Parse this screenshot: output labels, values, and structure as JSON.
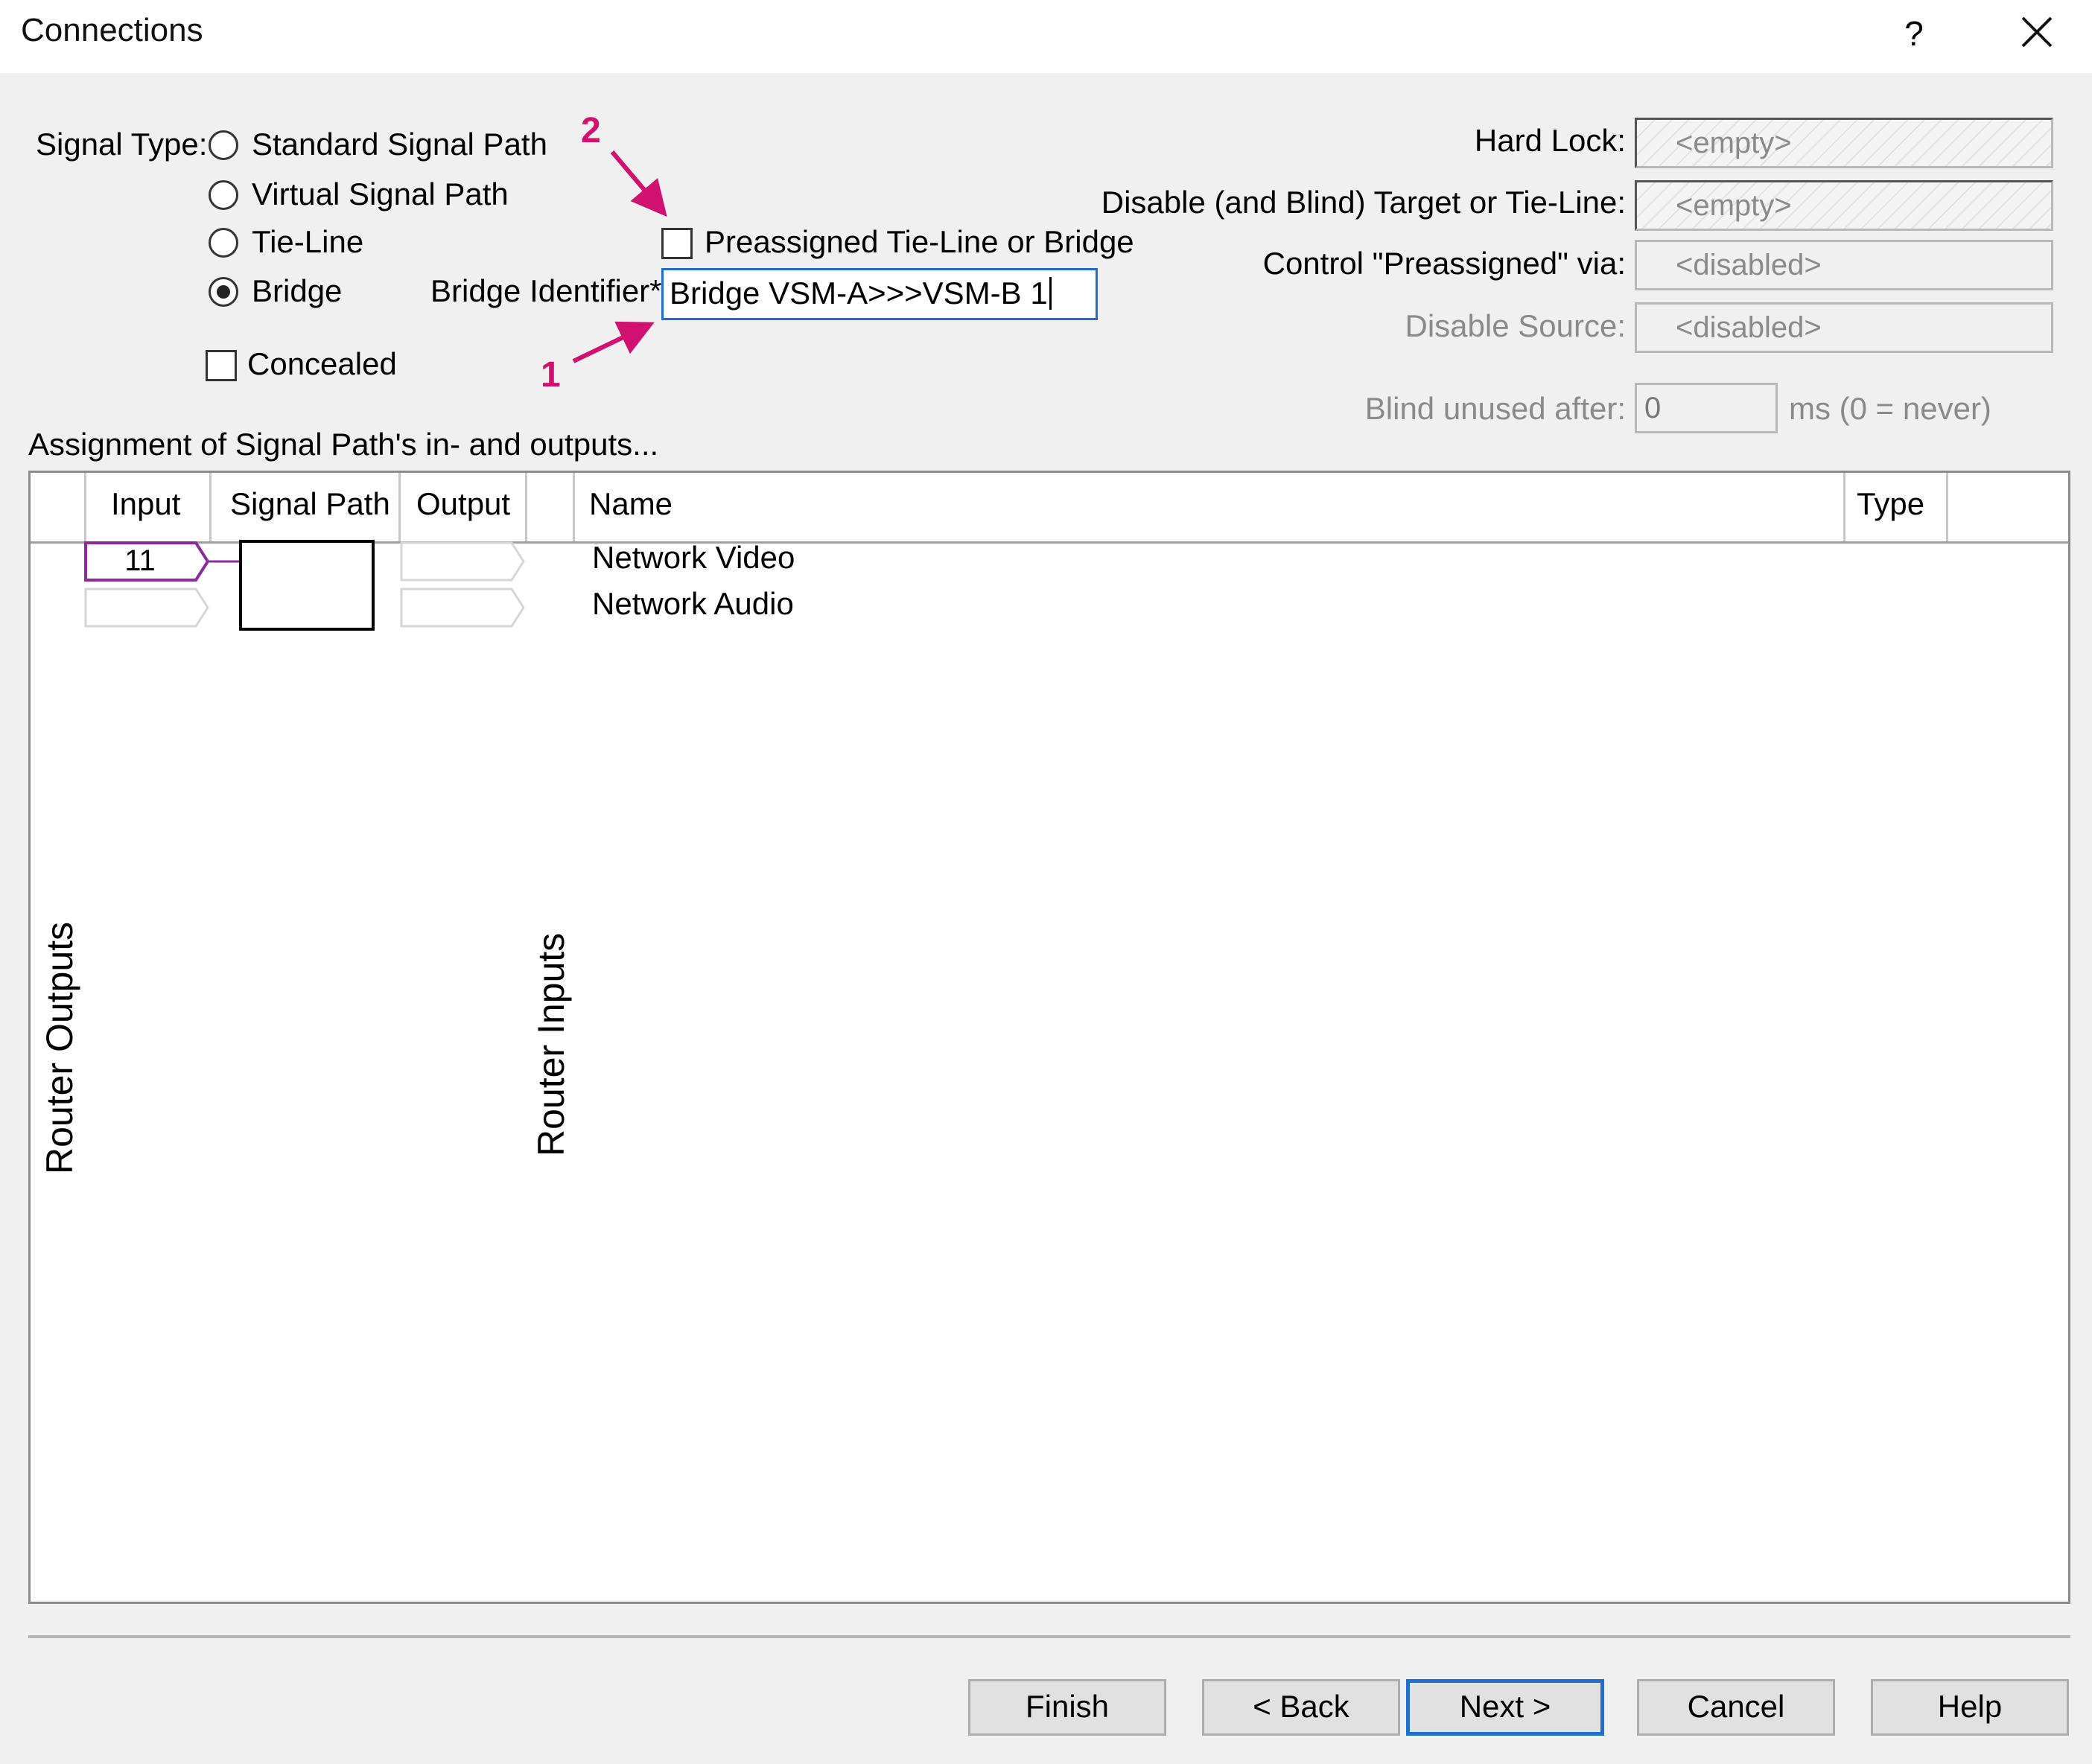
{
  "window": {
    "title": "Connections",
    "help_glyph": "?",
    "close_icon": "close-icon"
  },
  "signal_type": {
    "label": "Signal Type:",
    "options": [
      {
        "label": "Standard Signal Path",
        "checked": false
      },
      {
        "label": "Virtual Signal Path",
        "checked": false
      },
      {
        "label": "Tie-Line",
        "checked": false
      },
      {
        "label": "Bridge",
        "checked": true
      }
    ],
    "concealed_label": "Concealed",
    "concealed_checked": false,
    "preassigned_label": "Preassigned Tie-Line or Bridge",
    "preassigned_checked": false,
    "bridge_identifier_label": "Bridge Identifier*:",
    "bridge_identifier_value": "Bridge VSM-A>>>VSM-B 1"
  },
  "annotations": {
    "marker_1": "1",
    "marker_2": "2",
    "color": "#d0116f"
  },
  "right_panel": {
    "hard_lock_label": "Hard Lock:",
    "hard_lock_value": "<empty>",
    "disable_target_label": "Disable (and Blind) Target or Tie-Line:",
    "disable_target_value": "<empty>",
    "control_preassigned_label": "Control \"Preassigned\" via:",
    "control_preassigned_value": "<disabled>",
    "disable_source_label": "Disable Source:",
    "disable_source_value": "<disabled>",
    "blind_unused_label": "Blind unused after:",
    "blind_unused_value": "0",
    "blind_unused_unit": "ms (0 = never)"
  },
  "assignment": {
    "heading": "Assignment of Signal Path's in- and outputs...",
    "columns": [
      "Input",
      "Signal Path",
      "Output",
      "Name",
      "Type"
    ],
    "rows": [
      {
        "input": "11",
        "output": "",
        "name": "Network Video",
        "type": ""
      },
      {
        "input": "",
        "output": "",
        "name": "Network Audio",
        "type": ""
      }
    ],
    "router_outputs_label": "Router Outputs",
    "router_inputs_label": "Router Inputs",
    "assigned_color": "#8a2b9e"
  },
  "buttons": {
    "finish": "Finish",
    "back": "< Back",
    "next": "Next >",
    "cancel": "Cancel",
    "help": "Help"
  }
}
